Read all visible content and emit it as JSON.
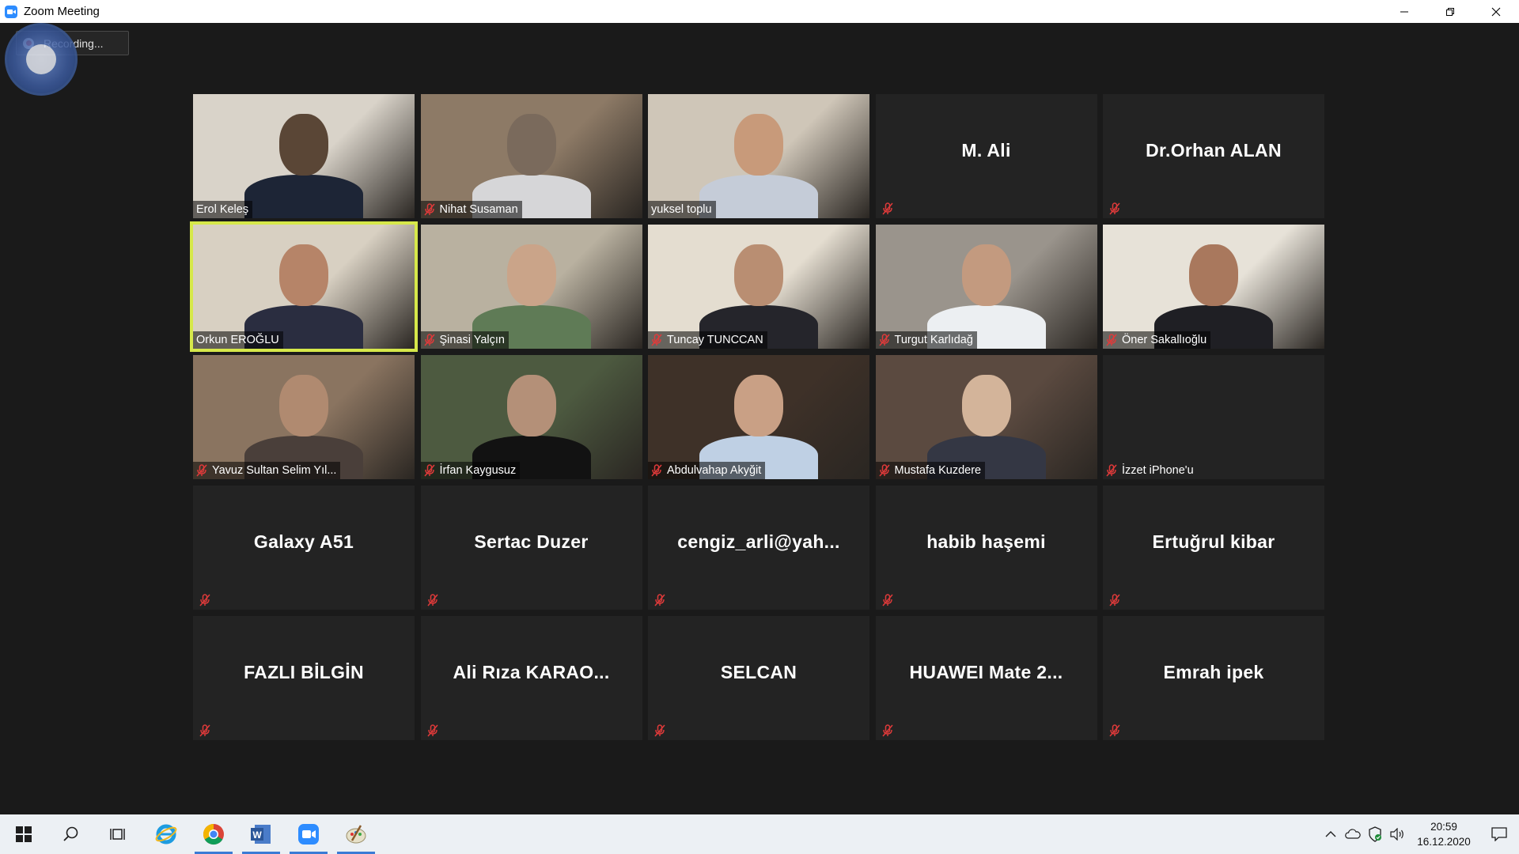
{
  "window": {
    "title": "Zoom Meeting",
    "icon": "zoom-icon",
    "controls": [
      "minimize-icon",
      "restore-icon",
      "close-icon"
    ]
  },
  "recording": {
    "label": "Recording..."
  },
  "active_speaker_color": "#d6e84a",
  "participants": [
    {
      "name": "Erol  Keleş",
      "video": true,
      "muted": false
    },
    {
      "name": "Nihat Susaman",
      "video": true,
      "muted": true
    },
    {
      "name": "yuksel toplu",
      "video": true,
      "muted": false
    },
    {
      "name": "M. Ali",
      "video": false,
      "muted": true
    },
    {
      "name": "Dr.Orhan ALAN",
      "video": false,
      "muted": true
    },
    {
      "name": "Orkun EROĞLU",
      "video": true,
      "muted": false,
      "active": true
    },
    {
      "name": "Şinasi Yalçın",
      "video": true,
      "muted": true
    },
    {
      "name": "Tuncay TUNCCAN",
      "video": true,
      "muted": true
    },
    {
      "name": "Turgut Karlıdağ",
      "video": true,
      "muted": true
    },
    {
      "name": "Öner Sakallıoğlu",
      "video": true,
      "muted": true
    },
    {
      "name": "Yavuz Sultan Selim Yıl...",
      "video": true,
      "muted": true
    },
    {
      "name": "İrfan Kaygusuz",
      "video": true,
      "muted": true
    },
    {
      "name": "Abdulvahap Akyğit",
      "video": true,
      "muted": true
    },
    {
      "name": "Mustafa Kuzdere",
      "video": true,
      "muted": true
    },
    {
      "name": "İzzet iPhone'u",
      "video": true,
      "muted": true,
      "blank": true
    },
    {
      "name": "Galaxy A51",
      "video": false,
      "muted": true
    },
    {
      "name": "Sertac Duzer",
      "video": false,
      "muted": true
    },
    {
      "name": "cengiz_arli@yah...",
      "video": false,
      "muted": true
    },
    {
      "name": "habib haşemi",
      "video": false,
      "muted": true
    },
    {
      "name": "Ertuğrul kibar",
      "video": false,
      "muted": true
    },
    {
      "name": "FAZLI BİLGİN",
      "video": false,
      "muted": true
    },
    {
      "name": "Ali  Rıza  KARAO...",
      "video": false,
      "muted": true
    },
    {
      "name": "SELCAN",
      "video": false,
      "muted": true
    },
    {
      "name": "HUAWEI  Mate  2...",
      "video": false,
      "muted": true
    },
    {
      "name": "Emrah ipek",
      "video": false,
      "muted": true
    }
  ],
  "taskbar": {
    "apps": [
      "windows-start-icon",
      "search-icon",
      "task-view-icon",
      "internet-explorer-icon",
      "chrome-icon",
      "word-icon",
      "zoom-icon",
      "paint-icon"
    ],
    "tray": [
      "chevron-up-icon",
      "onedrive-cloud-icon",
      "defender-shield-icon",
      "volume-icon"
    ],
    "time": "20:59",
    "date": "16.12.2020"
  }
}
